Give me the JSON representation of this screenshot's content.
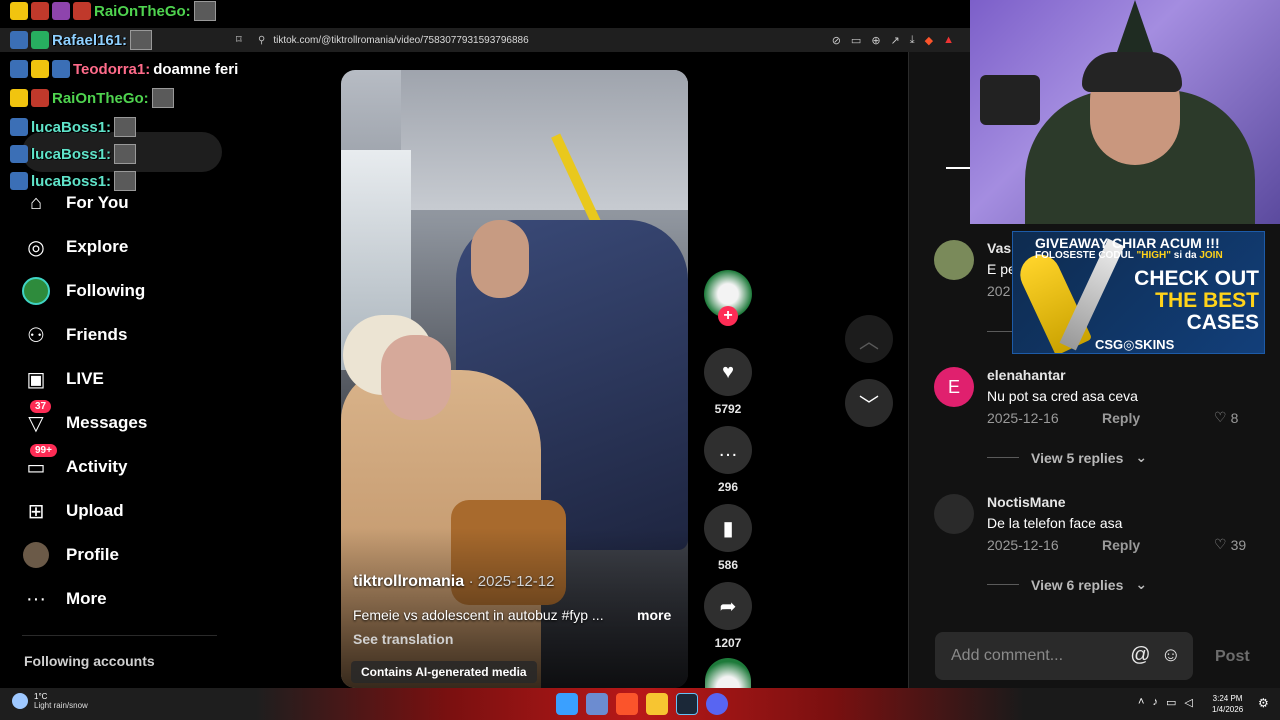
{
  "browser": {
    "url": "tiktok.com/@tiktrollromania/video/7583077931593796886"
  },
  "chat": [
    {
      "user": "RaiOnTheGo:",
      "color": "#4fd34f",
      "message": ""
    },
    {
      "user": "Rafael161:",
      "color": "#8fd0ff",
      "message": ""
    },
    {
      "user": "Teodorra1:",
      "color": "#ff6b8a",
      "message": "doamne feri"
    },
    {
      "user": "RaiOnTheGo:",
      "color": "#4fd34f",
      "message": ""
    },
    {
      "user": "lucaBoss1:",
      "color": "#5fe3c9",
      "message": ""
    },
    {
      "user": "lucaBoss1:",
      "color": "#5fe3c9",
      "message": ""
    },
    {
      "user": "lucaBoss1:",
      "color": "#5fe3c9",
      "message": ""
    }
  ],
  "sidebar": {
    "items": [
      {
        "label": "For You",
        "icon": "home-icon"
      },
      {
        "label": "Explore",
        "icon": "compass-icon"
      },
      {
        "label": "Following",
        "icon": "following-avatar-icon"
      },
      {
        "label": "Friends",
        "icon": "friends-icon"
      },
      {
        "label": "LIVE",
        "icon": "live-tv-icon"
      },
      {
        "label": "Messages",
        "icon": "messages-icon",
        "badge": "37"
      },
      {
        "label": "Activity",
        "icon": "activity-icon",
        "badge": "99+"
      },
      {
        "label": "Upload",
        "icon": "upload-icon"
      },
      {
        "label": "Profile",
        "icon": "profile-avatar-icon"
      },
      {
        "label": "More",
        "icon": "more-icon"
      }
    ],
    "following_accounts": "Following accounts"
  },
  "video": {
    "author": "tiktrollromania",
    "date": "· 2025-12-12",
    "caption": "Femeie vs adolescent in autobuz #fyp ...",
    "more": "more",
    "see_translation": "See translation",
    "ai_label": "Contains AI-generated media"
  },
  "actions": {
    "likes": "5792",
    "comments": "296",
    "saves": "586",
    "shares": "1207"
  },
  "comments": [
    {
      "name": "Vasi",
      "text": "E pe",
      "date": "202",
      "reply": "",
      "likes": "",
      "avatar": "#7a8a5a"
    },
    {
      "name": "elenahantar",
      "text": "Nu pot sa cred asa ceva",
      "date": "2025-12-16",
      "reply": "Reply",
      "likes": "8",
      "avatar": "#e0206e",
      "initial": "E",
      "replies": "View 5 replies"
    },
    {
      "name": "NoctisMane",
      "text": "De la telefon face asa",
      "date": "2025-12-16",
      "reply": "Reply",
      "likes": "39",
      "avatar": "#2a2a2a",
      "replies": "View 6 replies"
    }
  ],
  "comment_box": {
    "placeholder": "Add comment...",
    "post": "Post"
  },
  "ad": {
    "line1": "GIVEAWAY CHIAR ACUM !!!",
    "line2a": "FOLOSESTE CODUL ",
    "line2b": "\"HIGH\"",
    "line2c": " si da ",
    "line2d": "JOIN",
    "check1": "CHECK OUT",
    "check2": "THE BEST",
    "check3": "CASES",
    "brand": "CSG◎SKINS"
  },
  "taskbar": {
    "temp": "1°C",
    "weather": "Light rain/snow",
    "time": "3:24 PM",
    "date": "1/4/2026"
  }
}
